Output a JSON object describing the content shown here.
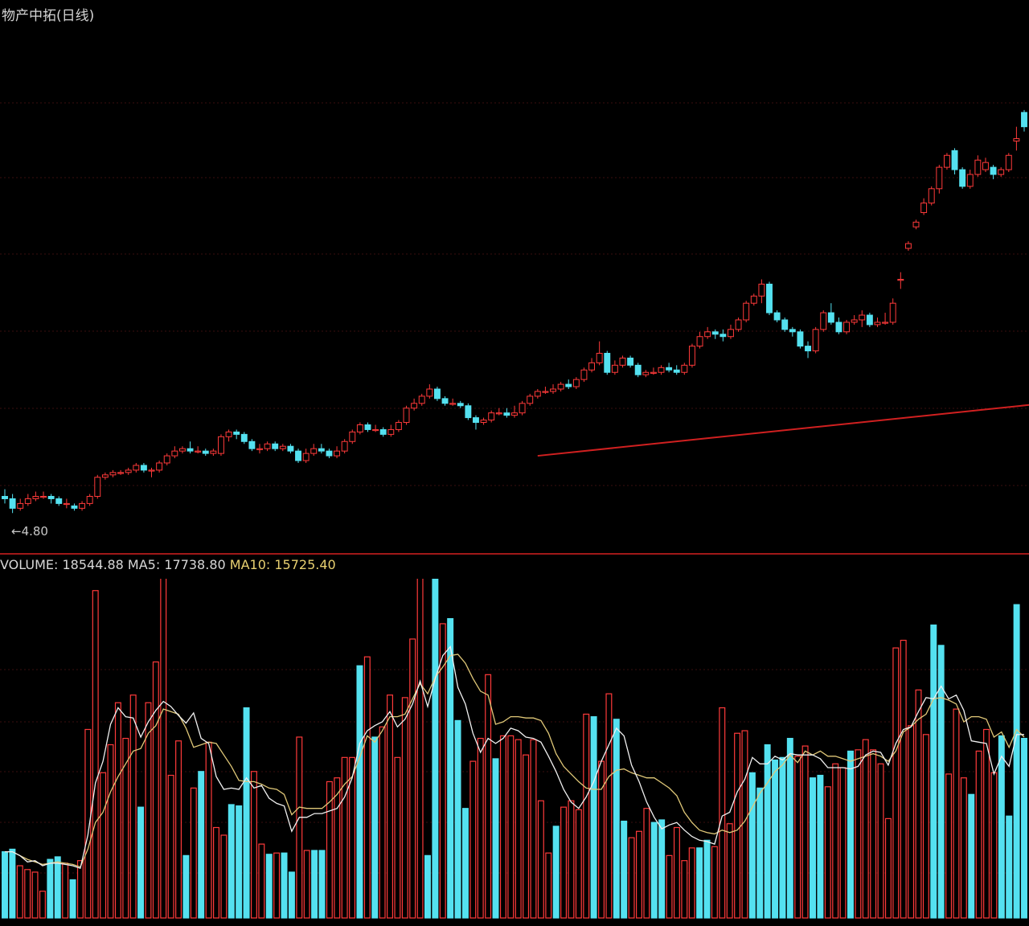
{
  "header": {
    "title": "物产中拓(日线)",
    "low_marker": "4.80"
  },
  "volume_header": {
    "label": "VOLUME: 18544.88",
    "ma5_label": "MA5: 17738.80",
    "ma10_label": "MA10: 15725.40"
  },
  "colors": {
    "up": "#ff3a3a",
    "down": "#54e1f0",
    "ma5": "#f0f0f0",
    "ma10": "#e0c878",
    "trendline": "#d02020",
    "divider": "#a01818"
  },
  "chart_data": [
    {
      "type": "candlestick",
      "title": "物产中拓(日线)",
      "annotations": [
        "4.80"
      ],
      "ylim": [
        4.7,
        6.5
      ],
      "candles": [
        [
          4.85,
          4.84,
          4.88,
          4.82
        ],
        [
          4.84,
          4.8,
          4.86,
          4.78
        ],
        [
          4.8,
          4.82,
          4.84,
          4.79
        ],
        [
          4.82,
          4.84,
          4.86,
          4.81
        ],
        [
          4.84,
          4.85,
          4.87,
          4.83
        ],
        [
          4.85,
          4.85,
          4.87,
          4.84
        ],
        [
          4.85,
          4.84,
          4.86,
          4.82
        ],
        [
          4.84,
          4.82,
          4.85,
          4.81
        ],
        [
          4.82,
          4.82,
          4.84,
          4.8
        ],
        [
          4.81,
          4.8,
          4.82,
          4.79
        ],
        [
          4.8,
          4.82,
          4.83,
          4.79
        ],
        [
          4.82,
          4.85,
          4.86,
          4.81
        ],
        [
          4.85,
          4.93,
          4.94,
          4.84
        ],
        [
          4.93,
          4.94,
          4.95,
          4.92
        ],
        [
          4.94,
          4.95,
          4.96,
          4.93
        ],
        [
          4.95,
          4.95,
          4.96,
          4.94
        ],
        [
          4.95,
          4.96,
          4.97,
          4.94
        ],
        [
          4.96,
          4.98,
          4.99,
          4.95
        ],
        [
          4.98,
          4.96,
          4.99,
          4.95
        ],
        [
          4.96,
          4.96,
          4.97,
          4.93
        ],
        [
          4.96,
          4.99,
          5.0,
          4.95
        ],
        [
          4.99,
          5.02,
          5.03,
          4.98
        ],
        [
          5.02,
          5.04,
          5.06,
          5.01
        ],
        [
          5.04,
          5.05,
          5.06,
          5.03
        ],
        [
          5.05,
          5.04,
          5.08,
          5.03
        ],
        [
          5.04,
          5.04,
          5.06,
          5.03
        ],
        [
          5.04,
          5.03,
          5.05,
          5.02
        ],
        [
          5.03,
          5.04,
          5.05,
          5.02
        ],
        [
          5.03,
          5.1,
          5.11,
          5.02
        ],
        [
          5.1,
          5.12,
          5.13,
          5.08
        ],
        [
          5.12,
          5.11,
          5.13,
          5.09
        ],
        [
          5.11,
          5.08,
          5.12,
          5.07
        ],
        [
          5.08,
          5.05,
          5.09,
          5.04
        ],
        [
          5.05,
          5.05,
          5.07,
          5.03
        ],
        [
          5.05,
          5.07,
          5.08,
          5.04
        ],
        [
          5.07,
          5.05,
          5.08,
          5.04
        ],
        [
          5.05,
          5.06,
          5.07,
          5.04
        ],
        [
          5.06,
          5.04,
          5.07,
          5.03
        ],
        [
          5.04,
          5.0,
          5.05,
          4.99
        ],
        [
          5.0,
          5.03,
          5.05,
          4.99
        ],
        [
          5.03,
          5.05,
          5.07,
          5.02
        ],
        [
          5.05,
          5.04,
          5.07,
          5.03
        ],
        [
          5.04,
          5.02,
          5.05,
          5.01
        ],
        [
          5.02,
          5.04,
          5.06,
          5.01
        ],
        [
          5.04,
          5.08,
          5.09,
          5.03
        ],
        [
          5.08,
          5.12,
          5.13,
          5.07
        ],
        [
          5.12,
          5.15,
          5.16,
          5.11
        ],
        [
          5.15,
          5.13,
          5.16,
          5.12
        ],
        [
          5.13,
          5.13,
          5.15,
          5.12
        ],
        [
          5.13,
          5.11,
          5.14,
          5.1
        ],
        [
          5.11,
          5.13,
          5.15,
          5.1
        ],
        [
          5.13,
          5.16,
          5.17,
          5.12
        ],
        [
          5.16,
          5.22,
          5.23,
          5.15
        ],
        [
          5.22,
          5.24,
          5.26,
          5.21
        ],
        [
          5.24,
          5.27,
          5.28,
          5.23
        ],
        [
          5.27,
          5.3,
          5.32,
          5.26
        ],
        [
          5.3,
          5.26,
          5.31,
          5.25
        ],
        [
          5.26,
          5.24,
          5.27,
          5.23
        ],
        [
          5.24,
          5.24,
          5.26,
          5.23
        ],
        [
          5.24,
          5.23,
          5.25,
          5.22
        ],
        [
          5.23,
          5.18,
          5.24,
          5.17
        ],
        [
          5.18,
          5.16,
          5.19,
          5.13
        ],
        [
          5.16,
          5.17,
          5.18,
          5.15
        ],
        [
          5.17,
          5.2,
          5.21,
          5.16
        ],
        [
          5.2,
          5.2,
          5.22,
          5.19
        ],
        [
          5.2,
          5.19,
          5.22,
          5.18
        ],
        [
          5.19,
          5.2,
          5.23,
          5.18
        ],
        [
          5.2,
          5.24,
          5.25,
          5.19
        ],
        [
          5.24,
          5.27,
          5.28,
          5.23
        ],
        [
          5.27,
          5.29,
          5.3,
          5.26
        ],
        [
          5.29,
          5.29,
          5.31,
          5.28
        ],
        [
          5.29,
          5.3,
          5.32,
          5.28
        ],
        [
          5.3,
          5.32,
          5.33,
          5.29
        ],
        [
          5.32,
          5.31,
          5.34,
          5.3
        ],
        [
          5.31,
          5.34,
          5.35,
          5.3
        ],
        [
          5.34,
          5.38,
          5.39,
          5.33
        ],
        [
          5.38,
          5.41,
          5.43,
          5.37
        ],
        [
          5.41,
          5.45,
          5.5,
          5.4
        ],
        [
          5.45,
          5.37,
          5.46,
          5.36
        ],
        [
          5.37,
          5.4,
          5.42,
          5.36
        ],
        [
          5.4,
          5.43,
          5.44,
          5.39
        ],
        [
          5.43,
          5.4,
          5.44,
          5.39
        ],
        [
          5.4,
          5.36,
          5.41,
          5.35
        ],
        [
          5.36,
          5.37,
          5.38,
          5.35
        ],
        [
          5.37,
          5.37,
          5.39,
          5.36
        ],
        [
          5.37,
          5.39,
          5.4,
          5.36
        ],
        [
          5.39,
          5.38,
          5.41,
          5.37
        ],
        [
          5.38,
          5.37,
          5.4,
          5.36
        ],
        [
          5.37,
          5.4,
          5.41,
          5.36
        ],
        [
          5.4,
          5.48,
          5.49,
          5.39
        ],
        [
          5.48,
          5.52,
          5.54,
          5.47
        ],
        [
          5.52,
          5.54,
          5.56,
          5.51
        ],
        [
          5.54,
          5.53,
          5.55,
          5.51
        ],
        [
          5.53,
          5.52,
          5.55,
          5.5
        ],
        [
          5.52,
          5.55,
          5.57,
          5.51
        ],
        [
          5.55,
          5.59,
          5.6,
          5.54
        ],
        [
          5.59,
          5.66,
          5.67,
          5.58
        ],
        [
          5.66,
          5.69,
          5.7,
          5.65
        ],
        [
          5.69,
          5.74,
          5.76,
          5.66
        ],
        [
          5.74,
          5.62,
          5.75,
          5.61
        ],
        [
          5.62,
          5.59,
          5.63,
          5.58
        ],
        [
          5.59,
          5.55,
          5.6,
          5.54
        ],
        [
          5.55,
          5.54,
          5.56,
          5.52
        ],
        [
          5.54,
          5.48,
          5.55,
          5.47
        ],
        [
          5.48,
          5.46,
          5.5,
          5.43
        ],
        [
          5.46,
          5.55,
          5.56,
          5.45
        ],
        [
          5.55,
          5.62,
          5.63,
          5.54
        ],
        [
          5.62,
          5.58,
          5.66,
          5.57
        ],
        [
          5.58,
          5.54,
          5.6,
          5.53
        ],
        [
          5.54,
          5.58,
          5.59,
          5.53
        ],
        [
          5.58,
          5.59,
          5.61,
          5.57
        ],
        [
          5.59,
          5.61,
          5.63,
          5.56
        ],
        [
          5.61,
          5.57,
          5.62,
          5.56
        ],
        [
          5.57,
          5.58,
          5.6,
          5.56
        ],
        [
          5.58,
          5.58,
          5.62,
          5.57
        ],
        [
          5.58,
          5.66,
          5.68,
          5.57
        ],
        [
          5.76,
          5.76,
          5.79,
          5.72
        ],
        [
          5.89,
          5.91,
          5.92,
          5.88
        ],
        [
          5.98,
          6.0,
          6.01,
          5.97
        ],
        [
          6.04,
          6.08,
          6.1,
          6.03
        ],
        [
          6.08,
          6.14,
          6.15,
          6.07
        ],
        [
          6.14,
          6.23,
          6.24,
          6.12
        ],
        [
          6.23,
          6.28,
          6.29,
          6.22
        ],
        [
          6.3,
          6.22,
          6.31,
          6.2
        ],
        [
          6.22,
          6.15,
          6.23,
          6.14
        ],
        [
          6.15,
          6.2,
          6.22,
          6.14
        ],
        [
          6.2,
          6.26,
          6.28,
          6.19
        ],
        [
          6.22,
          6.25,
          6.27,
          6.21
        ],
        [
          6.23,
          6.2,
          6.24,
          6.18
        ],
        [
          6.2,
          6.22,
          6.23,
          6.19
        ],
        [
          6.22,
          6.28,
          6.29,
          6.21
        ],
        [
          6.34,
          6.35,
          6.4,
          6.3
        ],
        [
          6.46,
          6.4,
          6.47,
          6.38
        ]
      ],
      "trendline": {
        "from": [
          69,
          5.02
        ],
        "to": [
          236,
          5.58
        ]
      }
    },
    {
      "type": "bar",
      "title": "VOLUME: 18544.88",
      "ylim": [
        0,
        26000
      ],
      "series": [
        {
          "name": "VOLUME",
          "values": [
            5200,
            5400,
            4100,
            3800,
            3600,
            2100,
            4600,
            4800,
            4300,
            3000,
            4500,
            14800,
            25700,
            11400,
            13600,
            16900,
            14100,
            17500,
            8700,
            16900,
            20100,
            27800,
            11200,
            13900,
            4900,
            10200,
            11500,
            13800,
            7100,
            6500,
            8900,
            8800,
            16500,
            11500,
            5800,
            5000,
            5100,
            5100,
            3600,
            14200,
            5300,
            5300,
            5300,
            10700,
            11000,
            12600,
            12600,
            19800,
            20500,
            14200,
            15000,
            17500,
            12600,
            17300,
            21900,
            29800,
            4900,
            31200,
            23100,
            23500,
            15500,
            8600,
            12300,
            14100,
            19100,
            12500,
            14300,
            14300,
            14000,
            12800,
            14000,
            9200,
            5100,
            7200,
            8700,
            9200,
            8500,
            16000,
            15800,
            12300,
            17600,
            15600,
            7600,
            6300,
            6800,
            8600,
            7500,
            7700,
            4900,
            7100,
            4500,
            5500,
            5500,
            6100,
            5600,
            16500,
            7400,
            14500,
            14700,
            11400,
            10200,
            13600,
            12400,
            12600,
            14100,
            12700,
            13500,
            11000,
            11200,
            10300,
            12100,
            11800,
            13100,
            13200,
            14000,
            13200,
            12100,
            7800,
            21200,
            21800,
            15100,
            17900,
            14400,
            23000,
            21400,
            11300,
            16400,
            11000,
            9700,
            13100,
            14800,
            11400,
            14300,
            8000,
            24600,
            14100
          ]
        },
        {
          "name": "MA5",
          "values": [
            5200,
            5200,
            4900,
            4400,
            4500,
            4100,
            4300,
            4300,
            4200,
            4100,
            3900,
            6500,
            10600,
            12300,
            15200,
            16500,
            15800,
            15700,
            14200,
            15400,
            16300,
            17000,
            16600,
            15900,
            15300,
            16100,
            14100,
            13700,
            11100,
            10100,
            10200,
            10100,
            11000,
            10200,
            10400,
            9400,
            9000,
            8800,
            6800,
            7900,
            7900,
            8200,
            8200,
            8400,
            8600,
            9500,
            11000,
            13700,
            14700,
            15100,
            15400,
            16200,
            15000,
            15600,
            16800,
            18600,
            16600,
            18800,
            20600,
            21300,
            18100,
            16800,
            14500,
            13000,
            14100,
            13700,
            14100,
            14900,
            14700,
            14200,
            14100,
            13800,
            12700,
            11500,
            10100,
            9100,
            8600,
            9500,
            10700,
            12300,
            13600,
            14900,
            14300,
            12000,
            10700,
            9100,
            7900,
            7000,
            7300,
            7500,
            6900,
            6400,
            6100,
            6000,
            5800,
            8000,
            8300,
            9900,
            10900,
            12600,
            12100,
            12100,
            12700,
            12400,
            12900,
            12800,
            12800,
            12800,
            12500,
            11800,
            11800,
            11800,
            11700,
            11900,
            12800,
            13100,
            13000,
            12000,
            13700,
            14800,
            15000,
            16200,
            17300,
            17200,
            18200,
            17200,
            17500,
            16300,
            13900,
            13800,
            13700,
            11300,
            12700,
            11900,
            14400,
            14400
          ]
        },
        {
          "name": "MA10",
          "values": [
            5200,
            5200,
            4900,
            4600,
            4400,
            4200,
            4300,
            4400,
            4300,
            4200,
            4000,
            5400,
            7500,
            8300,
            9900,
            11100,
            12100,
            13100,
            13300,
            14500,
            15100,
            16400,
            16200,
            16000,
            14900,
            13400,
            13600,
            13800,
            13700,
            12800,
            11900,
            10800,
            10700,
            10700,
            10500,
            10200,
            10100,
            9700,
            8100,
            8700,
            8600,
            8600,
            8600,
            9100,
            9700,
            10500,
            11100,
            12600,
            14300,
            13800,
            14700,
            15800,
            15800,
            16000,
            17200,
            18400,
            17600,
            18900,
            19700,
            20600,
            20700,
            20000,
            18800,
            17800,
            17500,
            15200,
            15400,
            15800,
            15800,
            15700,
            15700,
            15500,
            14500,
            12900,
            11900,
            11300,
            10700,
            10200,
            10100,
            10100,
            11100,
            11600,
            11700,
            11400,
            11200,
            11000,
            11000,
            10600,
            10200,
            9600,
            8300,
            7500,
            6900,
            6700,
            6600,
            6900,
            6700,
            6900,
            7600,
            8700,
            9800,
            10600,
            11500,
            12000,
            12800,
            12200,
            13100,
            12800,
            13100,
            12700,
            12700,
            12500,
            12300,
            12500,
            12700,
            12900,
            12700,
            12300,
            13100,
            14600,
            15000,
            15600,
            16000,
            17200,
            17300,
            17100,
            16800,
            15400,
            15800,
            15800,
            15600,
            14200,
            14600,
            13400,
            14800,
            14200
          ]
        }
      ],
      "ma_overlays": [
        "MA5",
        "MA10"
      ]
    }
  ]
}
